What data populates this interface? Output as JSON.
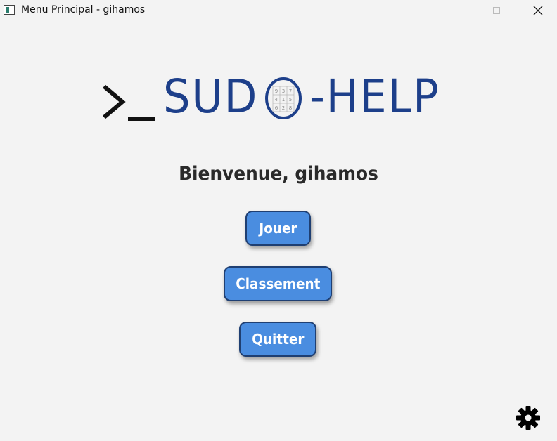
{
  "window": {
    "title": "Menu Principal - gihamos",
    "controls": {
      "minimize_glyph": "—",
      "maximize_glyph": "☐",
      "close_glyph": "✕"
    }
  },
  "logo": {
    "prompt_glyph": ">_",
    "left_text": "SUD",
    "right_text": "-HELP",
    "sudoku_digits": [
      "9",
      "3",
      "7",
      "4",
      "1",
      "5",
      "6",
      "2",
      "8"
    ],
    "color": "#1d3f8a"
  },
  "welcome": {
    "text": "Bienvenue, gihamos"
  },
  "buttons": {
    "play_label": "Jouer",
    "ranking_label": "Classement",
    "quit_label": "Quitter",
    "color": "#4a8de0",
    "border_color": "#1f3f72"
  },
  "settings": {
    "icon": "gear-icon"
  }
}
